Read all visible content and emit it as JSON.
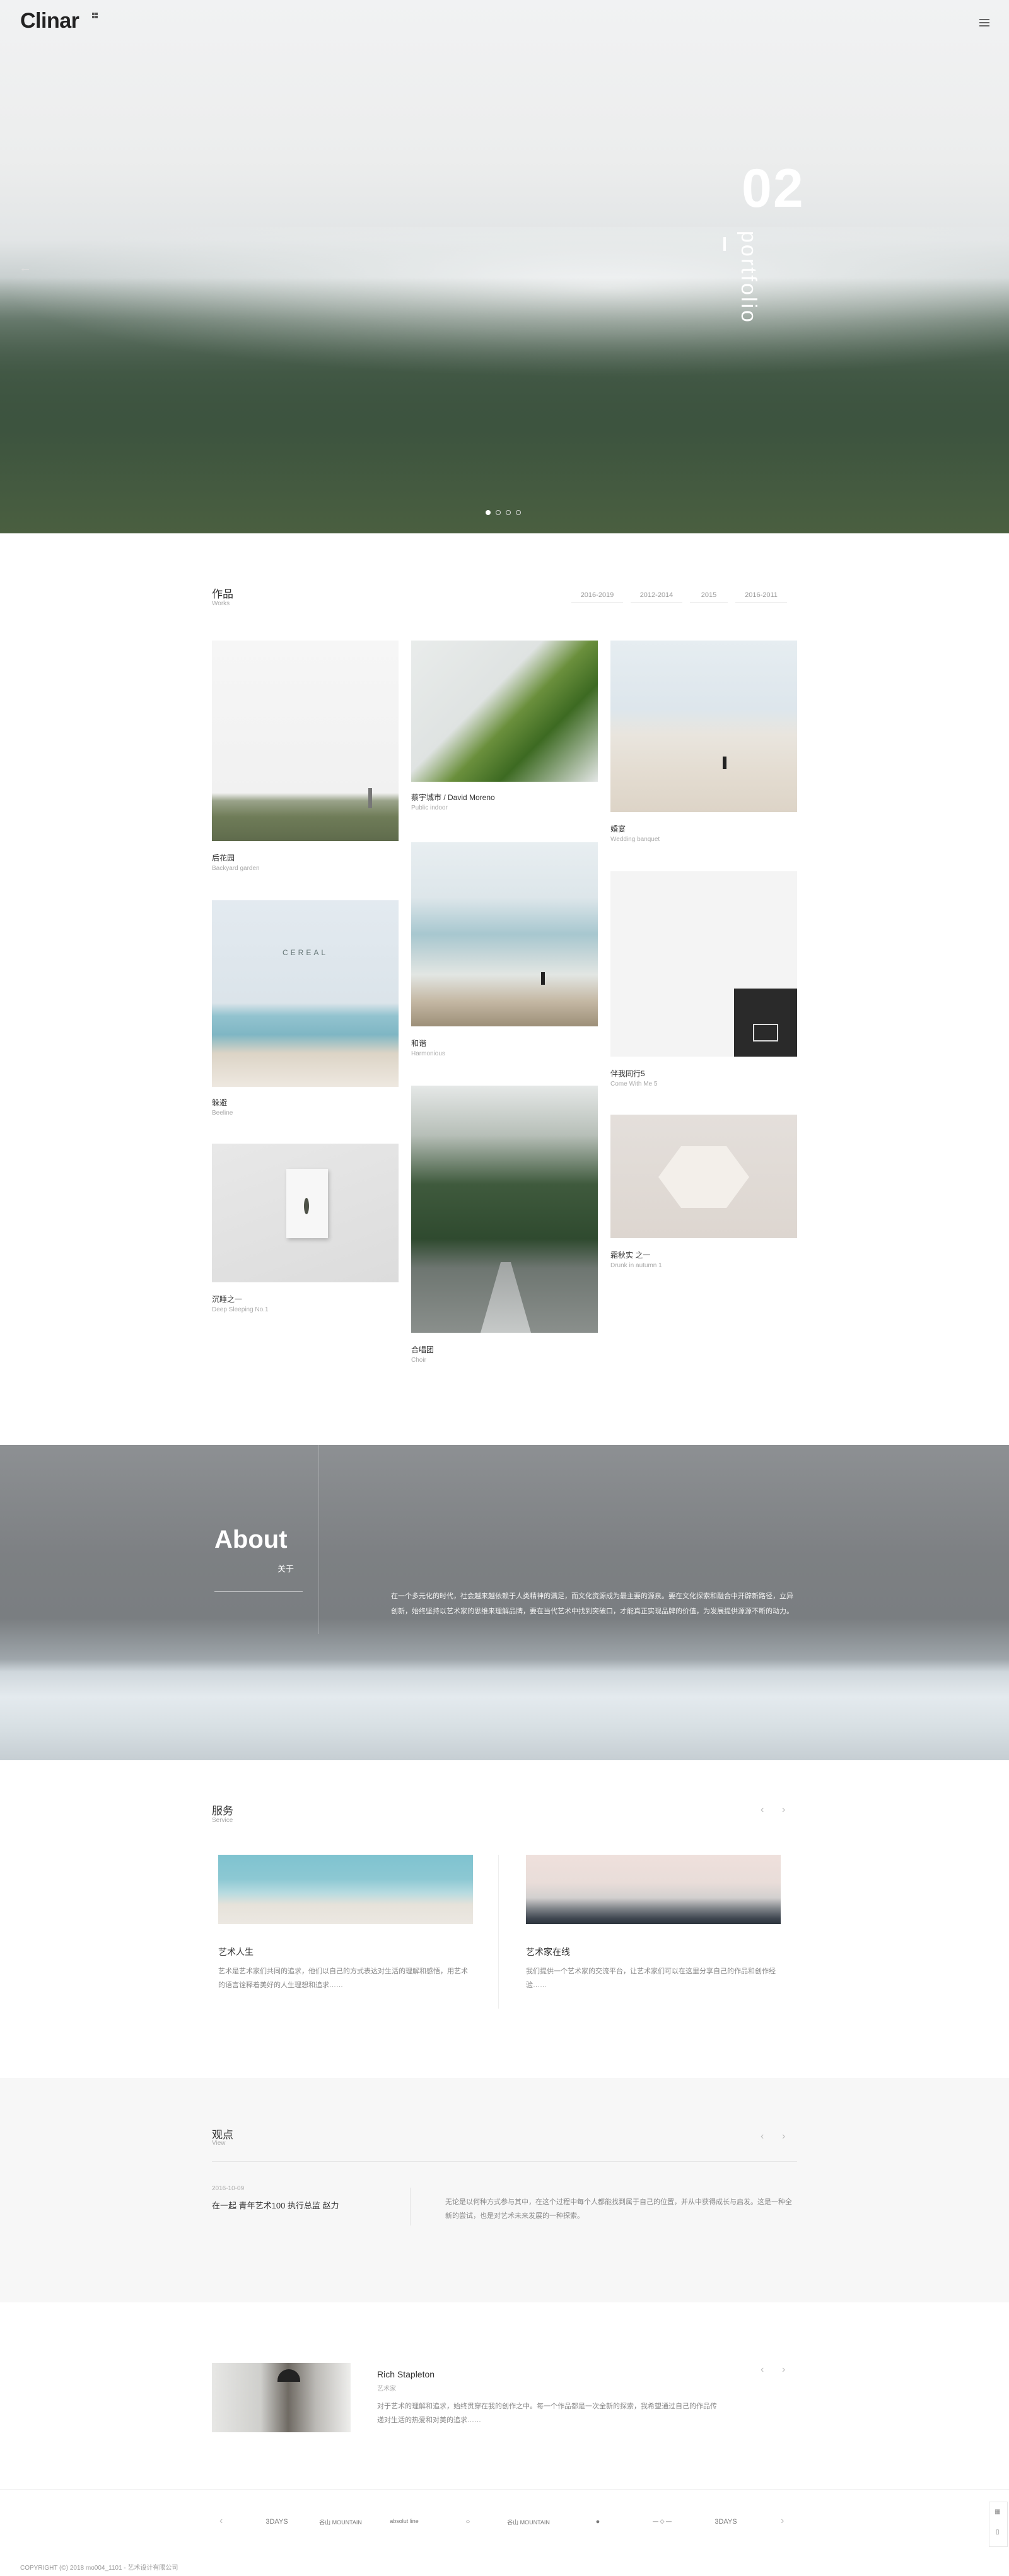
{
  "header": {
    "logo": "Clinar"
  },
  "hero": {
    "number": "02",
    "word": "portfolio"
  },
  "works": {
    "title": "作品",
    "subtitle": "Works",
    "year_tabs": [
      "2016-2019",
      "2012-2014",
      "2015",
      "2016-2011"
    ],
    "items": [
      {
        "cn": "后花园",
        "en": "Backyard garden"
      },
      {
        "cn": "蔡宇城市 / David Moreno",
        "en": "Public indoor"
      },
      {
        "cn": "婚宴",
        "en": "Wedding banquet"
      },
      {
        "cn": "躲避",
        "en": "Beeline"
      },
      {
        "cn": "和谐",
        "en": "Harmonious"
      },
      {
        "cn": "伴我同行5",
        "en": "Come With Me 5"
      },
      {
        "cn": "沉睡之一",
        "en": "Deep Sleeping No.1"
      },
      {
        "cn": "合唱团",
        "en": "Choir"
      },
      {
        "cn": "霜秋实 之一",
        "en": "Drunk in autumn 1"
      }
    ]
  },
  "about": {
    "title": "About",
    "subtitle": "关于",
    "text": "在一个多元化的时代，社会越来越依赖于人类精神的满足，而文化资源成为最主要的源泉。要在文化探索和融合中开辟新路径，立异创新，始终坚持以艺术家的思维来理解品牌，要在当代艺术中找到突破口，才能真正实现品牌的价值，为发展提供源源不断的动力。"
  },
  "services": {
    "title": "服务",
    "subtitle": "Service",
    "items": [
      {
        "title": "艺术人生",
        "text": "艺术是艺术家们共同的追求，他们以自己的方式表达对生活的理解和感悟，用艺术的语言诠释着美好的人生理想和追求……"
      },
      {
        "title": "艺术家在线",
        "text": "我们提供一个艺术家的交流平台，让艺术家们可以在这里分享自己的作品和创作经验……"
      }
    ]
  },
  "views": {
    "title": "观点",
    "subtitle": "View",
    "date": "2016-10-09",
    "headline": "在一起 青年艺术100 执行总监 赵力",
    "text": "无论是以何种方式参与其中，在这个过程中每个人都能找到属于自己的位置，并从中获得成长与启发。这是一种全新的尝试，也是对艺术未来发展的一种探索。"
  },
  "testimonial": {
    "name": "Rich Stapleton",
    "role": "艺术家",
    "text": "对于艺术的理解和追求，始终贯穿在我的创作之中。每一个作品都是一次全新的探索，我希望通过自己的作品传递对生活的热爱和对美的追求……"
  },
  "brands": [
    "3DAYS",
    "谷山 MOUNTAIN",
    "absolut line",
    "○",
    "谷山 MOUNTAIN",
    "●",
    "— ◇ —",
    "3DAYS"
  ],
  "footer": {
    "copyright": "COPYRIGHT (©) 2018 mo004_1101 - 艺术设计有限公司"
  },
  "colors": {
    "accent": "#333333",
    "muted": "#aaaaaa"
  }
}
